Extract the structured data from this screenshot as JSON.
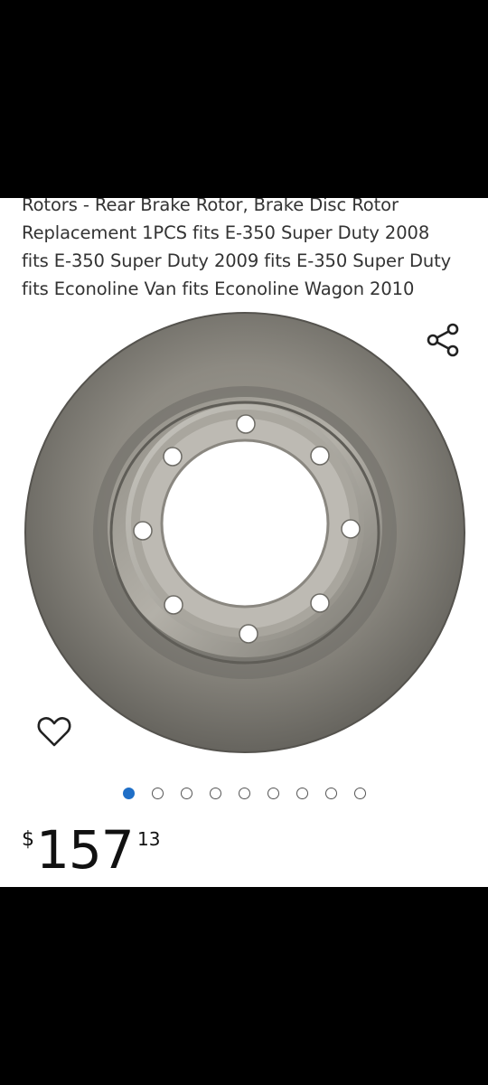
{
  "product": {
    "title_lines": [
      "Rotors - Rear Brake Rotor, Brake Disc Rotor",
      "Replacement 1PCS fits E-350 Super Duty 2008",
      "fits E-350 Super Duty 2009 fits E-350 Super Duty",
      "fits Econoline Van fits Econoline Wagon 2010"
    ],
    "price": {
      "symbol": "$",
      "whole": "157",
      "fraction": "13"
    }
  },
  "gallery": {
    "image_count": 9,
    "active_index": 0
  },
  "icons": {
    "share": "share-icon",
    "wishlist": "heart-icon"
  },
  "colors": {
    "active_dot": "#1f6fc7",
    "rotor_gray": "#8c8a82"
  }
}
